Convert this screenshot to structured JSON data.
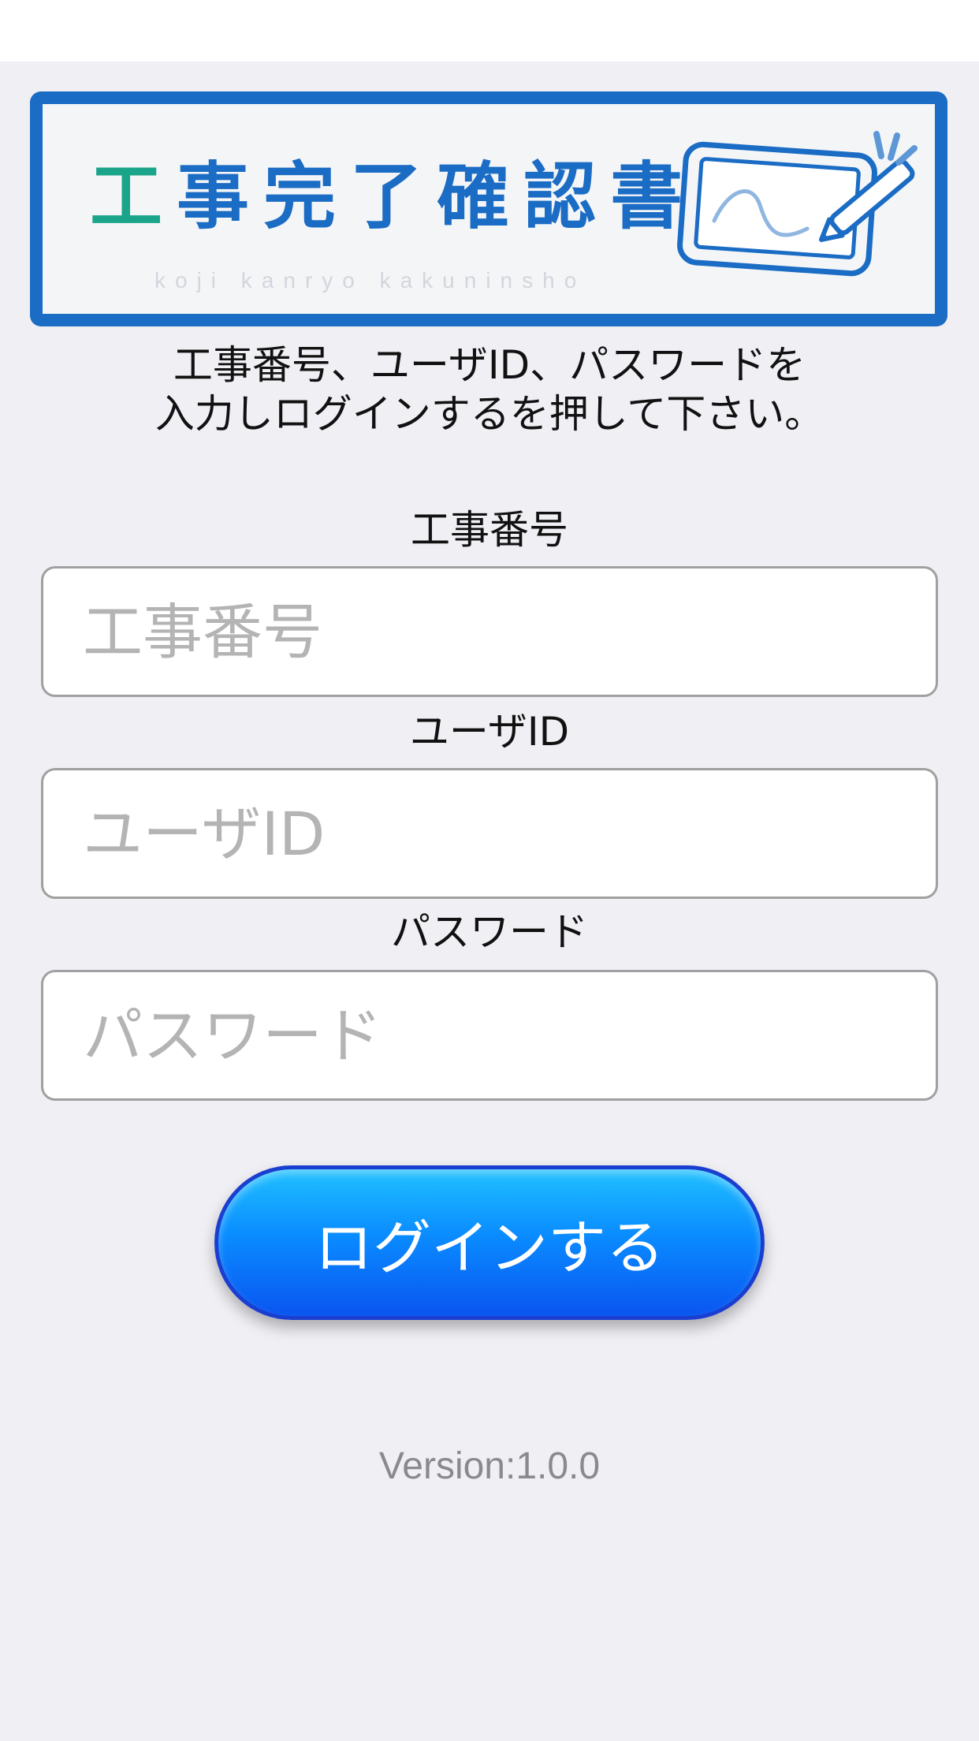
{
  "banner": {
    "title_chars": [
      {
        "char": "工",
        "color": "#1aa58a"
      },
      {
        "char": "事",
        "color": "#1a6cc4"
      },
      {
        "char": "完",
        "color": "#1a6cc4"
      },
      {
        "char": "了",
        "color": "#1a6cc4"
      },
      {
        "char": "確",
        "color": "#1a6cc4"
      },
      {
        "char": "認",
        "color": "#1a6cc4"
      },
      {
        "char": "書",
        "color": "#1a6cc4"
      }
    ],
    "subtitle": "koji kanryo kakuninsho",
    "illustration_icon": "tablet-stylus-icon",
    "border_color": "#1a6cc4"
  },
  "instruction": {
    "line1": "工事番号、ユーザID、パスワードを",
    "line2": "入力しログインするを押して下さい。"
  },
  "form": {
    "fields": [
      {
        "label": "工事番号",
        "placeholder": "工事番号",
        "value": ""
      },
      {
        "label": "ユーザID",
        "placeholder": "ユーザID",
        "value": ""
      },
      {
        "label": "パスワード",
        "placeholder": "パスワード",
        "value": ""
      }
    ],
    "login_label": "ログインする"
  },
  "footer": {
    "version": "Version:1.0.0"
  },
  "colors": {
    "background": "#efeff4",
    "button_top": "#20c0ff",
    "button_bottom": "#0a55f0",
    "accent_teal": "#1aa58a",
    "accent_blue": "#1a6cc4"
  }
}
